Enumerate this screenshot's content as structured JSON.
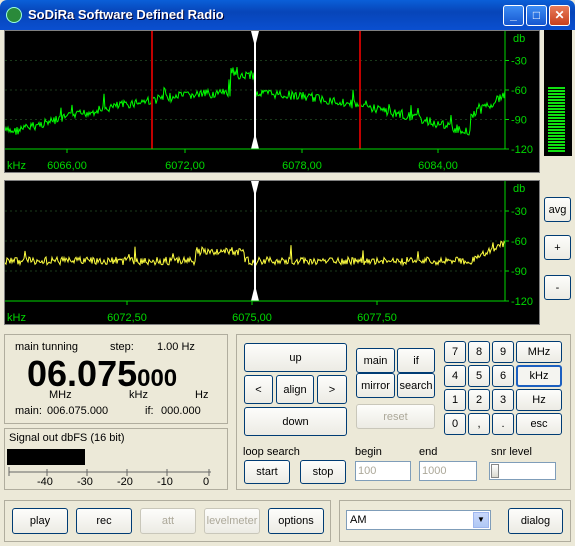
{
  "window": {
    "title": "SoDiRa Software Defined Radio",
    "min": "_",
    "max": "□",
    "close": "✕"
  },
  "top_scope": {
    "y_unit": "db",
    "y_ticks": [
      "-30",
      "-60",
      "-90",
      "-120"
    ],
    "x_unit": "kHz",
    "x_ticks": [
      "6066,00",
      "6072,00",
      "6078,00",
      "6084,00"
    ],
    "level_fraction": 0.55,
    "colors": {
      "trace": "#00ff00",
      "marker": "#c00000",
      "axis": "#00d800"
    }
  },
  "bottom_scope": {
    "y_unit": "db",
    "y_ticks": [
      "-30",
      "-60",
      "-90",
      "-120"
    ],
    "x_unit": "kHz",
    "x_ticks": [
      "6072,50",
      "6075,00",
      "6077,50"
    ],
    "colors": {
      "trace": "#ffff40",
      "axis": "#00d800"
    }
  },
  "scope_side": {
    "avg": "avg",
    "plus": "+",
    "minus": "-"
  },
  "tuning": {
    "title": "main tunning",
    "step_label": "step:",
    "step_value": "1.00  Hz",
    "freq_big": "06.075",
    "freq_small": "000",
    "unit_mhz": "MHz",
    "unit_khz": "kHz",
    "unit_hz": "Hz",
    "main_label": "main:",
    "main_value": "006.075.000",
    "if_label": "if:",
    "if_value": "000.000"
  },
  "signal": {
    "title": "Signal out dbFS (16 bit)",
    "level_fraction": 0.38,
    "scale": [
      "-40",
      "-30",
      "-20",
      "-10",
      "0"
    ]
  },
  "nav": {
    "up": "up",
    "left": "<",
    "align": "align",
    "right": ">",
    "down": "down"
  },
  "mode": {
    "main": "main",
    "if": "if",
    "mirror": "mirror",
    "search": "search",
    "reset": "reset"
  },
  "keypad": [
    "7",
    "8",
    "9",
    "MHz",
    "4",
    "5",
    "6",
    "kHz",
    "1",
    "2",
    "3",
    "Hz",
    "0",
    ",",
    ".",
    "esc"
  ],
  "loop": {
    "title": "loop search",
    "start": "start",
    "stop": "stop",
    "begin_label": "begin",
    "begin_value": "100",
    "end_label": "end",
    "end_value": "1000",
    "snr_label": "snr level"
  },
  "bottom": {
    "play": "play",
    "rec": "rec",
    "att": "att",
    "levelmeter": "levelmeter",
    "options": "options",
    "mode_select": "AM",
    "dialog": "dialog"
  }
}
